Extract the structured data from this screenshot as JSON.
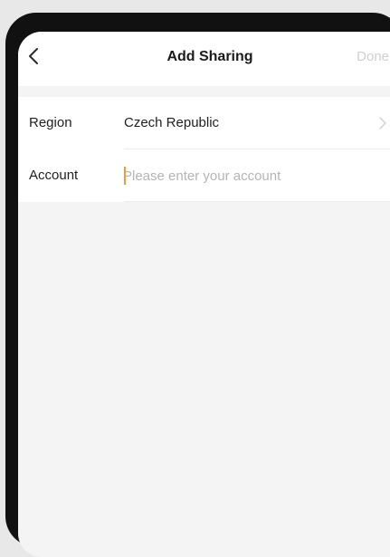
{
  "navbar": {
    "title": "Add Sharing",
    "done_label": "Done",
    "back_icon": "chevron-left-icon"
  },
  "form": {
    "region": {
      "label": "Region",
      "value": "Czech Republic",
      "icon": "chevron-right-icon"
    },
    "account": {
      "label": "Account",
      "value": "",
      "placeholder": "Please enter your account"
    }
  },
  "colors": {
    "accent_caret": "#f29a38",
    "done_disabled": "#cfcfcf",
    "background": "#f4f4f4"
  }
}
